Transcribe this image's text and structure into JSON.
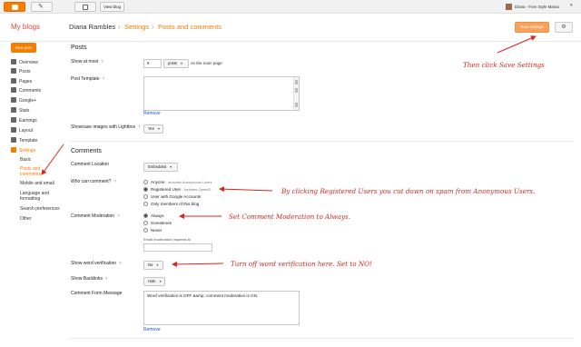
{
  "topbar": {
    "view_blog": "View blog",
    "account_name": "Diana - Free Style Mama"
  },
  "header": {
    "my_blogs": "My blogs",
    "blog_name": "Diana Rambles",
    "sep": "›",
    "crumbs": [
      "Settings",
      "Posts and comments"
    ],
    "save_label": "Save settings"
  },
  "sidebar": {
    "new_post": "New post",
    "items": [
      "Overview",
      "Posts",
      "Pages",
      "Comments",
      "Google+",
      "Stats",
      "Earnings",
      "Layout",
      "Template",
      "Settings"
    ],
    "sub_items": [
      "Basic",
      "Posts and comments",
      "Mobile and email",
      "Language and formatting",
      "Search preferences",
      "Other"
    ]
  },
  "posts": {
    "title": "Posts",
    "show_at_most_label": "Show at most",
    "show_at_most_value": "6",
    "posts_unit": "posts",
    "on_main_page": "on the main page",
    "post_template_label": "Post Template",
    "remove": "Remove",
    "lightbox_label": "Showcase images with Lightbox",
    "lightbox_value": "Yes"
  },
  "comments": {
    "title": "Comments",
    "location_label": "Comment Location",
    "location_value": "Embedded",
    "who_label": "Who can comment?",
    "who_options": [
      {
        "label": "Anyone",
        "note": " - includes Anonymous Users",
        "checked": false
      },
      {
        "label": "Registered User",
        "note": " - includes OpenID",
        "checked": true
      },
      {
        "label": "User with Google Accounts",
        "note": "",
        "checked": false
      },
      {
        "label": "Only members of this blog",
        "note": "",
        "checked": false
      }
    ],
    "moderation_label": "Comment Moderation",
    "moderation_options": [
      {
        "label": "Always",
        "checked": true
      },
      {
        "label": "Sometimes",
        "checked": false
      },
      {
        "label": "Never",
        "checked": false
      }
    ],
    "email_mod_label": "Email moderation requests to",
    "word_verif_label": "Show word verification",
    "word_verif_value": "No",
    "backlinks_label": "Show Backlinks",
    "backlinks_value": "Hide",
    "form_message_label": "Comment Form Message",
    "form_message_value": "Word verification is OFF &amp; comment moderation is ON.",
    "remove": "Remove"
  },
  "annotations": {
    "save": "Then click Save Settings",
    "registered": "By clicking Registered Users you cut down on spam from Anonymous Users.",
    "moderation": "Set Comment Moderation to Always.",
    "word_verif": "Turn off word verification here. Set to NO!"
  },
  "colors": {
    "accent": "#f57d00",
    "annotation": "#d7261e",
    "link": "#1155cc"
  }
}
